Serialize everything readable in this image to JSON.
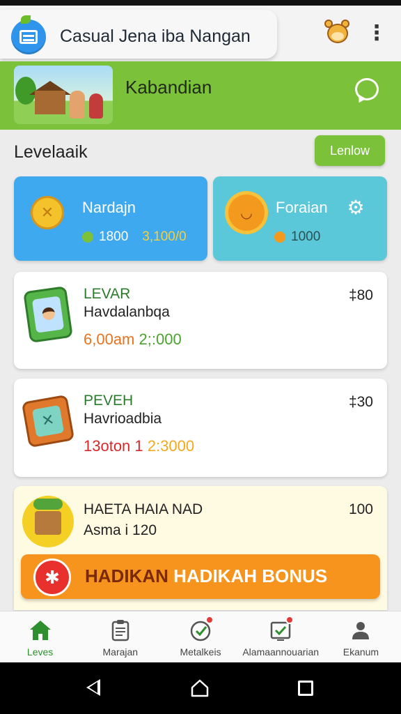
{
  "header": {
    "app_title": "Casual Jena iba Nangan",
    "logo_icon": "app-window-icon",
    "profile_icon": "bear-icon",
    "menu_icon": "more-vert-icon"
  },
  "banner": {
    "title": "Kabandian",
    "image": "village-illustration",
    "chat_icon": "chat-bubble-icon",
    "color": "#7cc13a"
  },
  "section": {
    "title": "Levelaaik",
    "button_label": "Lenlow"
  },
  "stats": [
    {
      "name": "Nardajn",
      "icon": "coin-icon",
      "value1": "1800",
      "value1_color": "#7cc13a",
      "value2": "3,100/0",
      "value2_color": "#f4d03f",
      "color": "#3fa9ef"
    },
    {
      "name": "Foraian",
      "icon": "sun-lion-icon",
      "value1": "1000",
      "value1_color": "#f39a1e",
      "color": "#5ac8d8",
      "extra_icon": "gear-icon"
    }
  ],
  "items": [
    {
      "title": "LEVAR",
      "subtitle": "Havdalanbqa",
      "value_a": "6,00am",
      "value_a_color": "#e8731e",
      "value_b": "2;:000",
      "value_b_color": "#4aa32c",
      "price": "‡80",
      "icon": "tablet-avatar-icon"
    },
    {
      "title": "PEVEH",
      "subtitle": "Havrioadbia",
      "value_a": "13oton",
      "value_a_color": "#d8282a",
      "value_b": "1",
      "value_b_color": "#d8282a",
      "value_c": "2:3000",
      "value_c_color": "#f2a91e",
      "price": "‡30",
      "icon": "puzzle-box-icon"
    },
    {
      "title": "HAETA HAIA NAD",
      "subtitle": "Asma i 120",
      "price": "100",
      "icon": "gift-box-icon"
    }
  ],
  "bonus": {
    "label_part1": "HADIKAN",
    "label_part2": "HADIKAH BONUS",
    "icon": "star-badge-icon",
    "color": "#f7941d"
  },
  "bottom_nav": [
    {
      "label": "Leves",
      "icon": "home-icon",
      "active": true
    },
    {
      "label": "Marajan",
      "icon": "clipboard-icon",
      "active": false
    },
    {
      "label": "Metalkeis",
      "icon": "check-circle-icon",
      "active": false,
      "badge": true
    },
    {
      "label": "Alamaannouarian",
      "icon": "checkbox-icon",
      "active": false,
      "badge": true
    },
    {
      "label": "Ekanum",
      "icon": "person-icon",
      "active": false
    }
  ]
}
